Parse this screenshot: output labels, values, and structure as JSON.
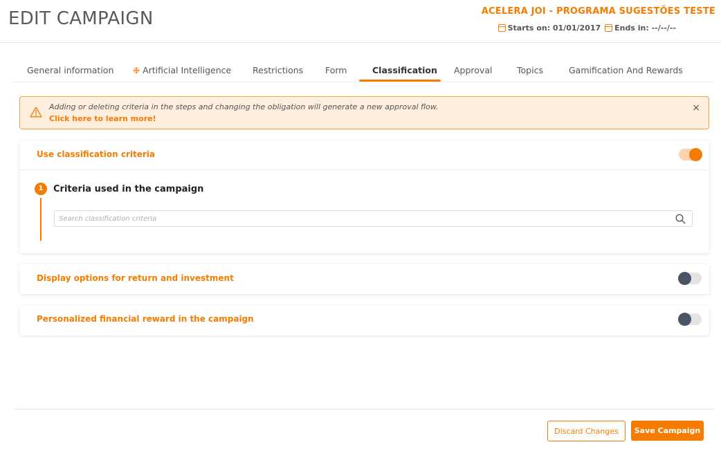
{
  "header": {
    "title": "EDIT CAMPAIGN",
    "campaign_name": "ACELERA JOI - PROGRAMA SUGESTÕES TESTE",
    "starts_label": "Starts on: 01/01/2017",
    "ends_label": "Ends in: --/--/--",
    "calendar_icon": "calendar-icon"
  },
  "tabs": [
    {
      "label": "General information"
    },
    {
      "label": "Artificial Intelligence",
      "icon": "sparkle-icon"
    },
    {
      "label": "Restrictions"
    },
    {
      "label": "Form"
    },
    {
      "label": "Classification",
      "active": true
    },
    {
      "label": "Approval"
    },
    {
      "label": "Topics"
    },
    {
      "label": "Gamification And Rewards"
    }
  ],
  "alert": {
    "message": "Adding or deleting criteria in the steps and changing the obligation will generate a new approval flow.",
    "link": "Click here to learn more!",
    "close": "×",
    "icon": "warning-icon"
  },
  "classification": {
    "title": "Use classification criteria",
    "enabled": true,
    "step_number": "1",
    "step_title": "Criteria used in the campaign",
    "search_placeholder": "Search classification criteria",
    "search_value": ""
  },
  "return_investment": {
    "title": "Display options for return and investment",
    "enabled": false
  },
  "financial_reward": {
    "title": "Personalized financial reward in the campaign",
    "enabled": false
  },
  "footer": {
    "discard_label": "Discard Changes",
    "save_label": "Save Campaign"
  },
  "colors": {
    "accent": "#f57c00",
    "alert_bg": "#fdeede",
    "toggle_off_knob": "#4a5563"
  }
}
